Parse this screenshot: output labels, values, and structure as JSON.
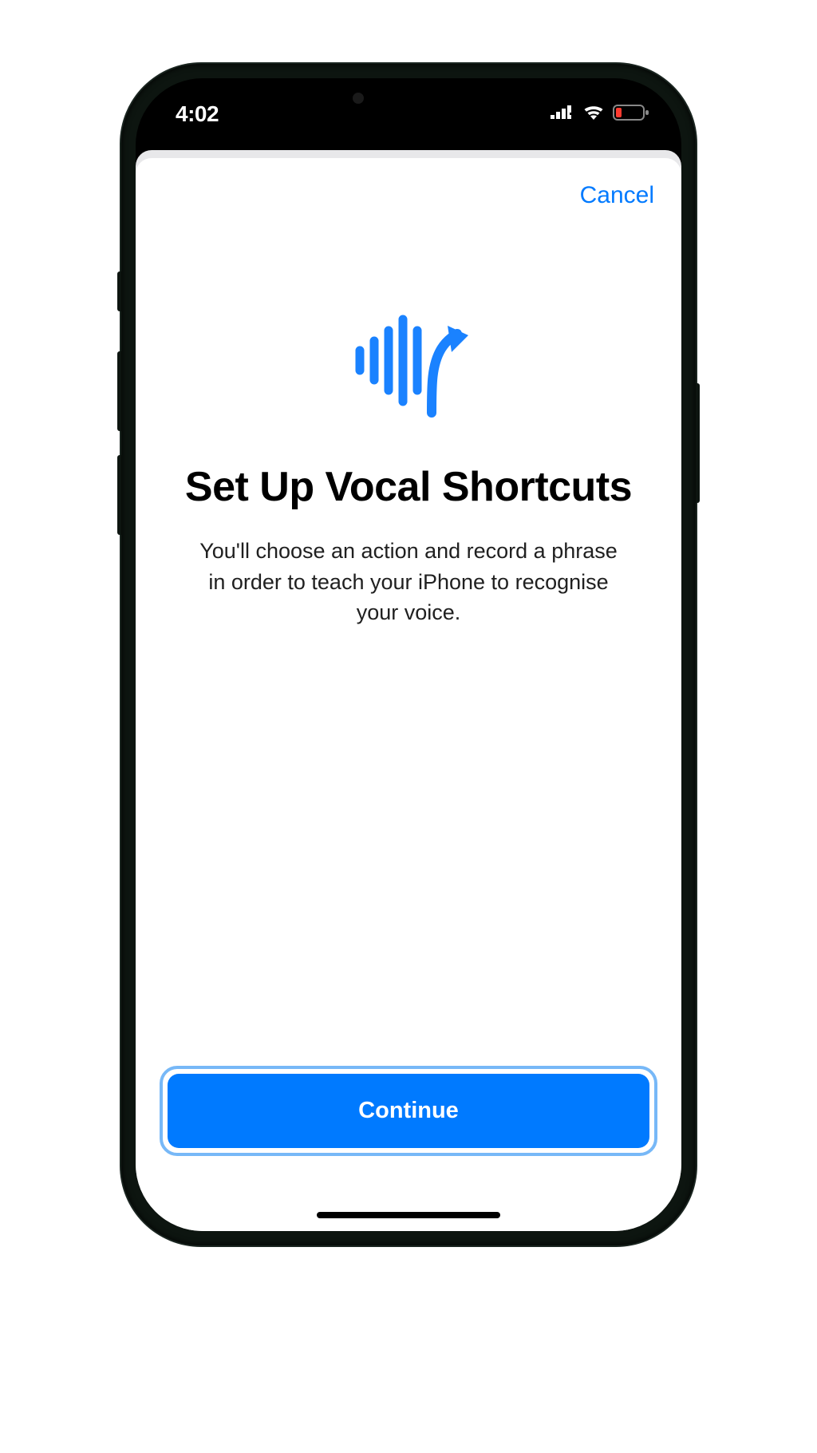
{
  "status": {
    "time": "4:02"
  },
  "sheet": {
    "cancel_label": "Cancel",
    "title": "Set Up Vocal Shortcuts",
    "description": "You'll choose an action and record a phrase in order to teach your iPhone to recognise your voice.",
    "continue_label": "Continue"
  },
  "colors": {
    "accent": "#007aff"
  }
}
